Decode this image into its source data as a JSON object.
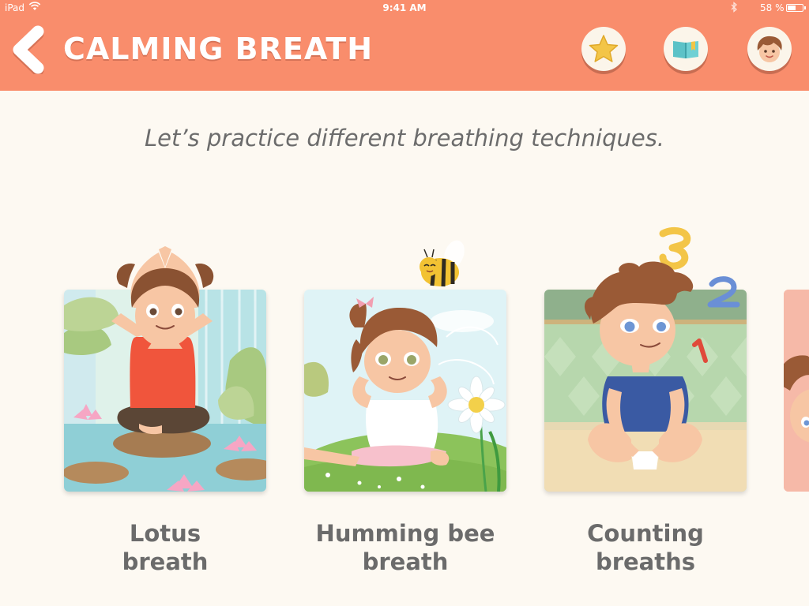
{
  "status_bar": {
    "device": "iPad",
    "time": "9:41 AM",
    "battery_percent": "58 %",
    "battery_level": 0.58
  },
  "header": {
    "title": "CALMING BREATH",
    "background_color": "#f98d6c",
    "buttons": [
      {
        "icon": "star-icon"
      },
      {
        "icon": "book-icon"
      },
      {
        "icon": "avatar-icon"
      }
    ]
  },
  "subtitle": "Let’s practice different breathing techniques.",
  "cards": [
    {
      "label": "Lotus breath",
      "illustration": "lotus-breath-illustration"
    },
    {
      "label": "Humming bee breath",
      "illustration": "humming-bee-illustration"
    },
    {
      "label": "Counting breaths",
      "illustration": "counting-breaths-illustration"
    }
  ],
  "label_color": "#6b6b6b"
}
